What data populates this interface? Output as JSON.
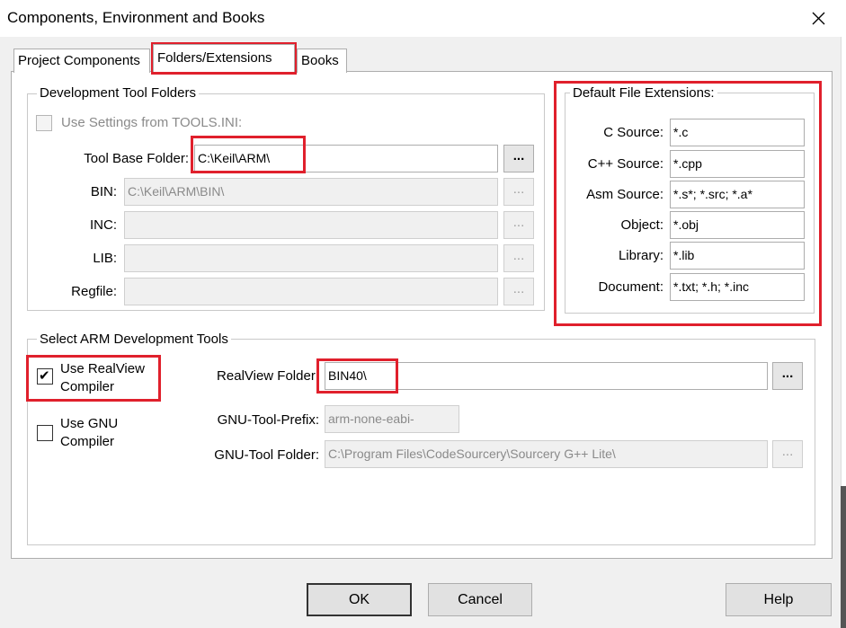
{
  "window": {
    "title": "Components, Environment and Books"
  },
  "tabs": [
    {
      "label": "Project Components"
    },
    {
      "label": "Folders/Extensions"
    },
    {
      "label": "Books"
    }
  ],
  "dev_tool_folders": {
    "title": "Development Tool Folders",
    "use_tools_ini_label": "Use Settings from TOOLS.INI:",
    "tool_base_label": "Tool Base Folder:",
    "tool_base_value": "C:\\Keil\\ARM\\",
    "bin_label": "BIN:",
    "bin_value": "C:\\Keil\\ARM\\BIN\\",
    "inc_label": "INC:",
    "inc_value": "",
    "lib_label": "LIB:",
    "lib_value": "",
    "regfile_label": "Regfile:",
    "regfile_value": "",
    "browse_label": "..."
  },
  "default_extensions": {
    "title": "Default File Extensions:",
    "rows": [
      {
        "label": "C Source:",
        "value": "*.c"
      },
      {
        "label": "C++ Source:",
        "value": "*.cpp"
      },
      {
        "label": "Asm Source:",
        "value": "*.s*; *.src; *.a*"
      },
      {
        "label": "Object:",
        "value": "*.obj"
      },
      {
        "label": "Library:",
        "value": "*.lib"
      },
      {
        "label": "Document:",
        "value": "*.txt; *.h; *.inc"
      }
    ]
  },
  "arm_tools": {
    "title": "Select ARM Development Tools",
    "realview_label_1": "Use RealView",
    "realview_label_2": "Compiler",
    "realview_checked": true,
    "gnu_label_1": "Use GNU",
    "gnu_label_2": "Compiler",
    "gnu_checked": false,
    "realview_folder_label": "RealView Folder:",
    "realview_folder_value": "BIN40\\",
    "gnu_prefix_label": "GNU-Tool-Prefix:",
    "gnu_prefix_value": "arm-none-eabi-",
    "gnu_folder_label": "GNU-Tool Folder:",
    "gnu_folder_value": "C:\\Program Files\\CodeSourcery\\Sourcery G++ Lite\\",
    "browse_label": "..."
  },
  "buttons": {
    "ok": "OK",
    "cancel": "Cancel",
    "help": "Help"
  },
  "icons": {
    "close": "close-icon",
    "check": "checkmark-icon"
  },
  "colors": {
    "highlight": "#e0202c"
  }
}
